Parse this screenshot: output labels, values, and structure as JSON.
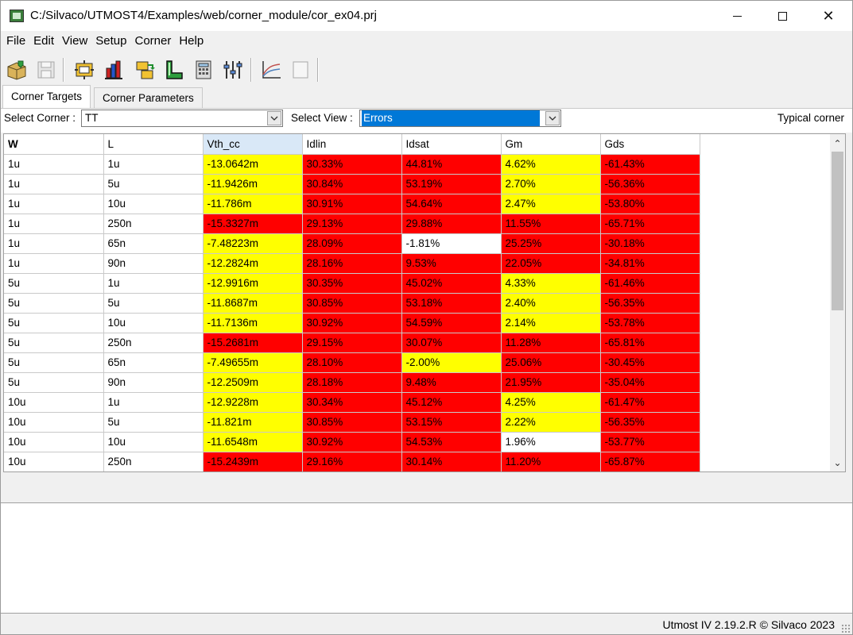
{
  "window": {
    "title": "C:/Silvaco/UTMOST4/Examples/web/corner_module/cor_ex04.prj",
    "icon": "app-icon",
    "controls": [
      "minimize-icon",
      "maximize-icon",
      "close-icon"
    ],
    "close_glyph": "✕"
  },
  "menu": [
    "File",
    "Edit",
    "View",
    "Setup",
    "Corner",
    "Help"
  ],
  "toolbar": {
    "icons": [
      "open-project-icon",
      "save-icon",
      "settings-icon",
      "bar-chart-icon",
      "transfer-icon",
      "layout-icon",
      "calculator-icon",
      "sliders-icon",
      "plot-icon",
      "blank-page-icon"
    ]
  },
  "tabs": [
    {
      "label": "Corner Targets",
      "active": true
    },
    {
      "label": "Corner Parameters",
      "active": false
    }
  ],
  "selectors": {
    "corner_label": "Select Corner :",
    "corner_value": "TT",
    "view_label": "Select View :",
    "view_value": "Errors",
    "typical_label": "Typical corner"
  },
  "table": {
    "columns": [
      "W",
      "L",
      "Vth_cc",
      "Idlin",
      "Idsat",
      "Gm",
      "Gds"
    ],
    "rows": [
      [
        "1u",
        "1u",
        "-13.0642m",
        "30.33%",
        "44.81%",
        "4.62%",
        "-61.43%"
      ],
      [
        "1u",
        "5u",
        "-11.9426m",
        "30.84%",
        "53.19%",
        "2.70%",
        "-56.36%"
      ],
      [
        "1u",
        "10u",
        "-11.786m",
        "30.91%",
        "54.64%",
        "2.47%",
        "-53.80%"
      ],
      [
        "1u",
        "250n",
        "-15.3327m",
        "29.13%",
        "29.88%",
        "11.55%",
        "-65.71%"
      ],
      [
        "1u",
        "65n",
        "-7.48223m",
        "28.09%",
        "-1.81%",
        "25.25%",
        "-30.18%"
      ],
      [
        "1u",
        "90n",
        "-12.2824m",
        "28.16%",
        "9.53%",
        "22.05%",
        "-34.81%"
      ],
      [
        "5u",
        "1u",
        "-12.9916m",
        "30.35%",
        "45.02%",
        "4.33%",
        "-61.46%"
      ],
      [
        "5u",
        "5u",
        "-11.8687m",
        "30.85%",
        "53.18%",
        "2.40%",
        "-56.35%"
      ],
      [
        "5u",
        "10u",
        "-11.7136m",
        "30.92%",
        "54.59%",
        "2.14%",
        "-53.78%"
      ],
      [
        "5u",
        "250n",
        "-15.2681m",
        "29.15%",
        "30.07%",
        "11.28%",
        "-65.81%"
      ],
      [
        "5u",
        "65n",
        "-7.49655m",
        "28.10%",
        "-2.00%",
        "25.06%",
        "-30.45%"
      ],
      [
        "5u",
        "90n",
        "-12.2509m",
        "28.18%",
        "9.48%",
        "21.95%",
        "-35.04%"
      ],
      [
        "10u",
        "1u",
        "-12.9228m",
        "30.34%",
        "45.12%",
        "4.25%",
        "-61.47%"
      ],
      [
        "10u",
        "5u",
        "-11.821m",
        "30.85%",
        "53.15%",
        "2.22%",
        "-56.35%"
      ],
      [
        "10u",
        "10u",
        "-11.6548m",
        "30.92%",
        "54.53%",
        "1.96%",
        "-53.77%"
      ],
      [
        "10u",
        "250n",
        "-15.2439m",
        "29.16%",
        "30.14%",
        "11.20%",
        "-65.87%"
      ]
    ],
    "cell_colors": [
      [
        "yellow",
        "red",
        "red",
        "yellow",
        "red"
      ],
      [
        "yellow",
        "red",
        "red",
        "yellow",
        "red"
      ],
      [
        "yellow",
        "red",
        "red",
        "yellow",
        "red"
      ],
      [
        "red",
        "red",
        "red",
        "red",
        "red"
      ],
      [
        "yellow",
        "red",
        "white",
        "red",
        "red"
      ],
      [
        "yellow",
        "red",
        "red",
        "red",
        "red"
      ],
      [
        "yellow",
        "red",
        "red",
        "yellow",
        "red"
      ],
      [
        "yellow",
        "red",
        "red",
        "yellow",
        "red"
      ],
      [
        "yellow",
        "red",
        "red",
        "yellow",
        "red"
      ],
      [
        "red",
        "red",
        "red",
        "red",
        "red"
      ],
      [
        "yellow",
        "red",
        "yellow",
        "red",
        "red"
      ],
      [
        "yellow",
        "red",
        "red",
        "red",
        "red"
      ],
      [
        "yellow",
        "red",
        "red",
        "yellow",
        "red"
      ],
      [
        "yellow",
        "red",
        "red",
        "yellow",
        "red"
      ],
      [
        "yellow",
        "red",
        "red",
        "white",
        "red"
      ],
      [
        "red",
        "red",
        "red",
        "red",
        "red"
      ]
    ],
    "scroll_up_glyph": "⌃",
    "scroll_down_glyph": "⌄"
  },
  "colors": {
    "yellow": "#ffff00",
    "red": "#ff0000",
    "white": "#ffffff",
    "selection": "#0078d7"
  },
  "status": {
    "text": "Utmost IV 2.19.2.R © Silvaco 2023"
  }
}
